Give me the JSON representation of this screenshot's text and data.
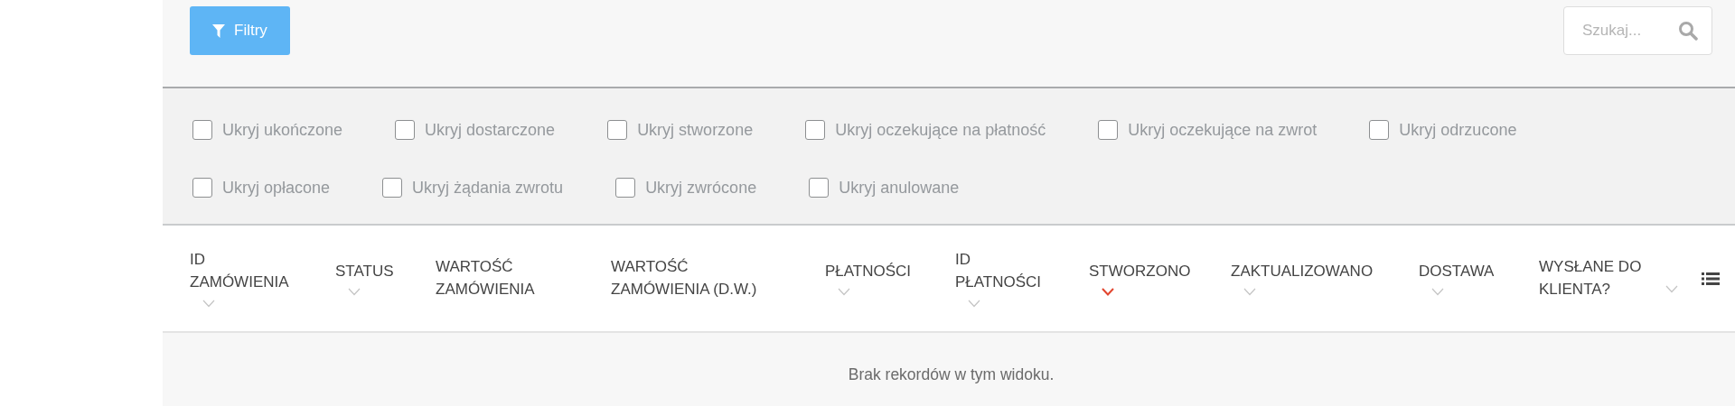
{
  "toolbar": {
    "filter_button": "Filtry",
    "search": {
      "placeholder": "Szukaj..."
    }
  },
  "filter_rows": [
    [
      {
        "label": "Ukryj ukończone",
        "checked": false
      },
      {
        "label": "Ukryj dostarczone",
        "checked": false
      },
      {
        "label": "Ukryj stworzone",
        "checked": false
      },
      {
        "label": "Ukryj oczekujące na płatność",
        "checked": false
      },
      {
        "label": "Ukryj oczekujące na zwrot",
        "checked": false
      },
      {
        "label": "Ukryj odrzucone",
        "checked": false
      }
    ],
    [
      {
        "label": "Ukryj opłacone",
        "checked": false
      },
      {
        "label": "Ukryj żądania zwrotu",
        "checked": false
      },
      {
        "label": "Ukryj zwrócone",
        "checked": false
      },
      {
        "label": "Ukryj anulowane",
        "checked": false
      }
    ]
  ],
  "table": {
    "columns": [
      {
        "label": "ID ZAMÓWIENIA",
        "kind": "sortable",
        "sorted": false
      },
      {
        "label": "STATUS",
        "kind": "sortable",
        "sorted": false
      },
      {
        "label": "WARTOŚĆ ZAMÓWIENIA",
        "kind": "plain"
      },
      {
        "label": "WARTOŚĆ ZAMÓWIENIA (D.W.)",
        "kind": "plain"
      },
      {
        "label": "PŁATNOŚCI",
        "kind": "sortable",
        "sorted": false
      },
      {
        "label": "ID PŁATNOŚCI",
        "kind": "sortable",
        "sorted": false
      },
      {
        "label": "STWORZONO",
        "kind": "sortable",
        "sorted": true
      },
      {
        "label": "ZAKTUALIZOWANO",
        "kind": "sortable",
        "sorted": false
      },
      {
        "label": "DOSTAWA",
        "kind": "sortable",
        "sorted": false
      },
      {
        "label": "WYSŁANE DO KLIENTA?",
        "kind": "sortable",
        "sorted": false
      }
    ],
    "empty_message": "Brak rekordów w tym widoku."
  }
}
